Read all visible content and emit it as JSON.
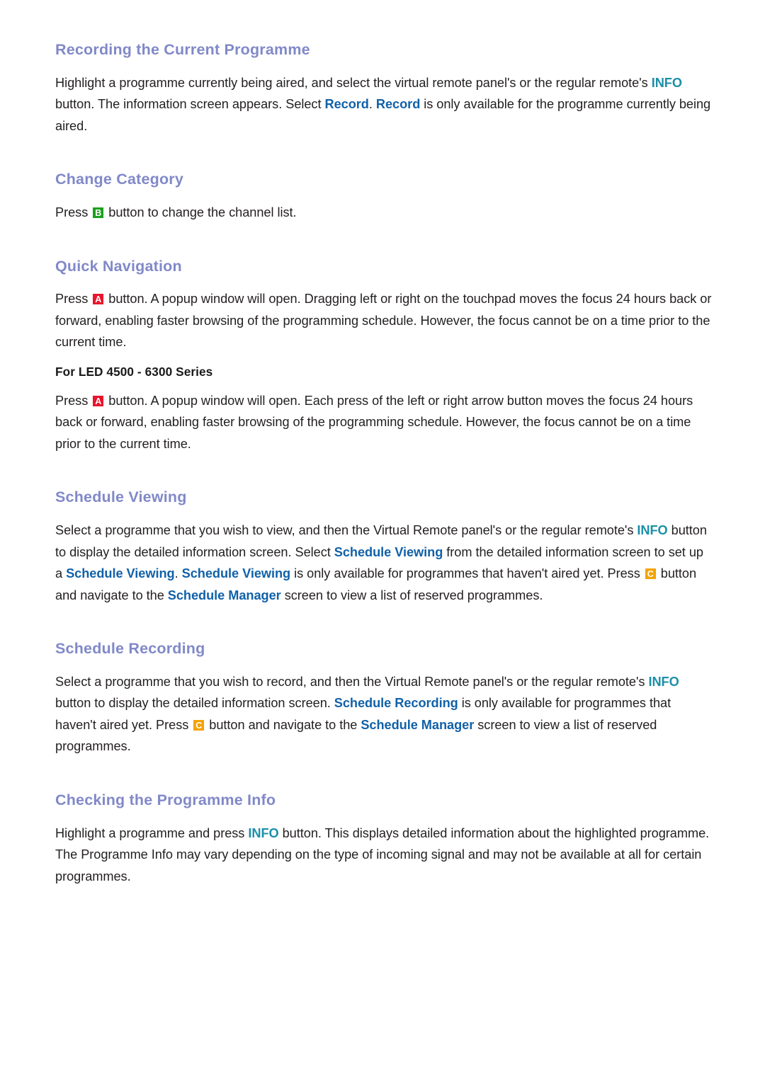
{
  "document": {
    "background_color": "#ffffff",
    "heading_color": "#8189c8",
    "body_color": "#231f20",
    "link_info_color": "#1b8fa8",
    "link_blue_color": "#1161a8",
    "key_a_color": "#e8142d",
    "key_b_color": "#19a11e",
    "key_c_color": "#f5a300"
  },
  "sections": [
    {
      "id": "recording-the-current-programme",
      "title": "Recording the Current Programme",
      "paragraph_runs": [
        {
          "text": "Highlight a programme currently being aired, and select the virtual remote panel's or the regular remote's ",
          "style": "normal"
        },
        {
          "text": "INFO",
          "style": "info"
        },
        {
          "text": " button. The information screen appears. Select ",
          "style": "normal"
        },
        {
          "text": "Record",
          "style": "blue"
        },
        {
          "text": ". ",
          "style": "normal"
        },
        {
          "text": "Record",
          "style": "blue"
        },
        {
          "text": " is only available for the programme currently being aired.",
          "style": "normal"
        }
      ]
    },
    {
      "id": "change-category",
      "title": "Change Category",
      "paragraph_runs": [
        {
          "text": "Press ",
          "style": "normal"
        },
        {
          "text": "B",
          "style": "key-b"
        },
        {
          "text": " button to change the channel list.",
          "style": "normal"
        }
      ]
    },
    {
      "id": "quick-navigation",
      "title": "Quick Navigation",
      "paragraph_runs": [
        {
          "text": "Press ",
          "style": "normal"
        },
        {
          "text": "A",
          "style": "key-a"
        },
        {
          "text": " button. A popup window will open. Dragging left or right on the touchpad moves the focus 24 hours back or forward, enabling faster browsing of the programming schedule. However, the focus cannot be on a time prior to the current time.",
          "style": "normal"
        }
      ],
      "sub_heading": "For LED 4500 - 6300 Series",
      "sub_paragraph_runs": [
        {
          "text": "Press ",
          "style": "normal"
        },
        {
          "text": "A",
          "style": "key-a"
        },
        {
          "text": " button. A popup window will open. Each press of the left or right arrow button moves the focus 24 hours back or forward, enabling faster browsing of the programming schedule. However, the focus cannot be on a time prior to the current time.",
          "style": "normal"
        }
      ]
    },
    {
      "id": "schedule-viewing",
      "title": "Schedule Viewing",
      "paragraph_runs": [
        {
          "text": "Select a programme that you wish to view, and then the Virtual Remote panel's or the regular remote's ",
          "style": "normal"
        },
        {
          "text": "INFO",
          "style": "info"
        },
        {
          "text": " button to display the detailed information screen. Select ",
          "style": "normal"
        },
        {
          "text": "Schedule Viewing",
          "style": "blue"
        },
        {
          "text": " from the detailed information screen to set up a ",
          "style": "normal"
        },
        {
          "text": "Schedule Viewing",
          "style": "blue"
        },
        {
          "text": ". ",
          "style": "normal"
        },
        {
          "text": "Schedule Viewing",
          "style": "blue"
        },
        {
          "text": " is only available for programmes that haven't aired yet. Press ",
          "style": "normal"
        },
        {
          "text": "C",
          "style": "key-c"
        },
        {
          "text": " button and navigate to the ",
          "style": "normal"
        },
        {
          "text": "Schedule Manager",
          "style": "blue"
        },
        {
          "text": " screen to view a list of reserved programmes.",
          "style": "normal"
        }
      ]
    },
    {
      "id": "schedule-recording",
      "title": "Schedule Recording",
      "paragraph_runs": [
        {
          "text": "Select a programme that you wish to record, and then the Virtual Remote panel's or the regular remote's ",
          "style": "normal"
        },
        {
          "text": "INFO",
          "style": "info"
        },
        {
          "text": " button to display the detailed information screen. ",
          "style": "normal"
        },
        {
          "text": "Schedule Recording",
          "style": "blue"
        },
        {
          "text": " is only available for programmes that haven't aired yet. Press ",
          "style": "normal"
        },
        {
          "text": "C",
          "style": "key-c"
        },
        {
          "text": " button and navigate to the ",
          "style": "normal"
        },
        {
          "text": "Schedule Manager",
          "style": "blue"
        },
        {
          "text": " screen to view a list of reserved programmes.",
          "style": "normal"
        }
      ]
    },
    {
      "id": "checking-the-programme-info",
      "title": "Checking the Programme Info",
      "paragraph_runs": [
        {
          "text": "Highlight a programme and press ",
          "style": "normal"
        },
        {
          "text": "INFO",
          "style": "info"
        },
        {
          "text": " button. This displays detailed information about the highlighted programme. The Programme Info may vary depending on the type of incoming signal and may not be available at all for certain programmes.",
          "style": "normal"
        }
      ]
    }
  ]
}
